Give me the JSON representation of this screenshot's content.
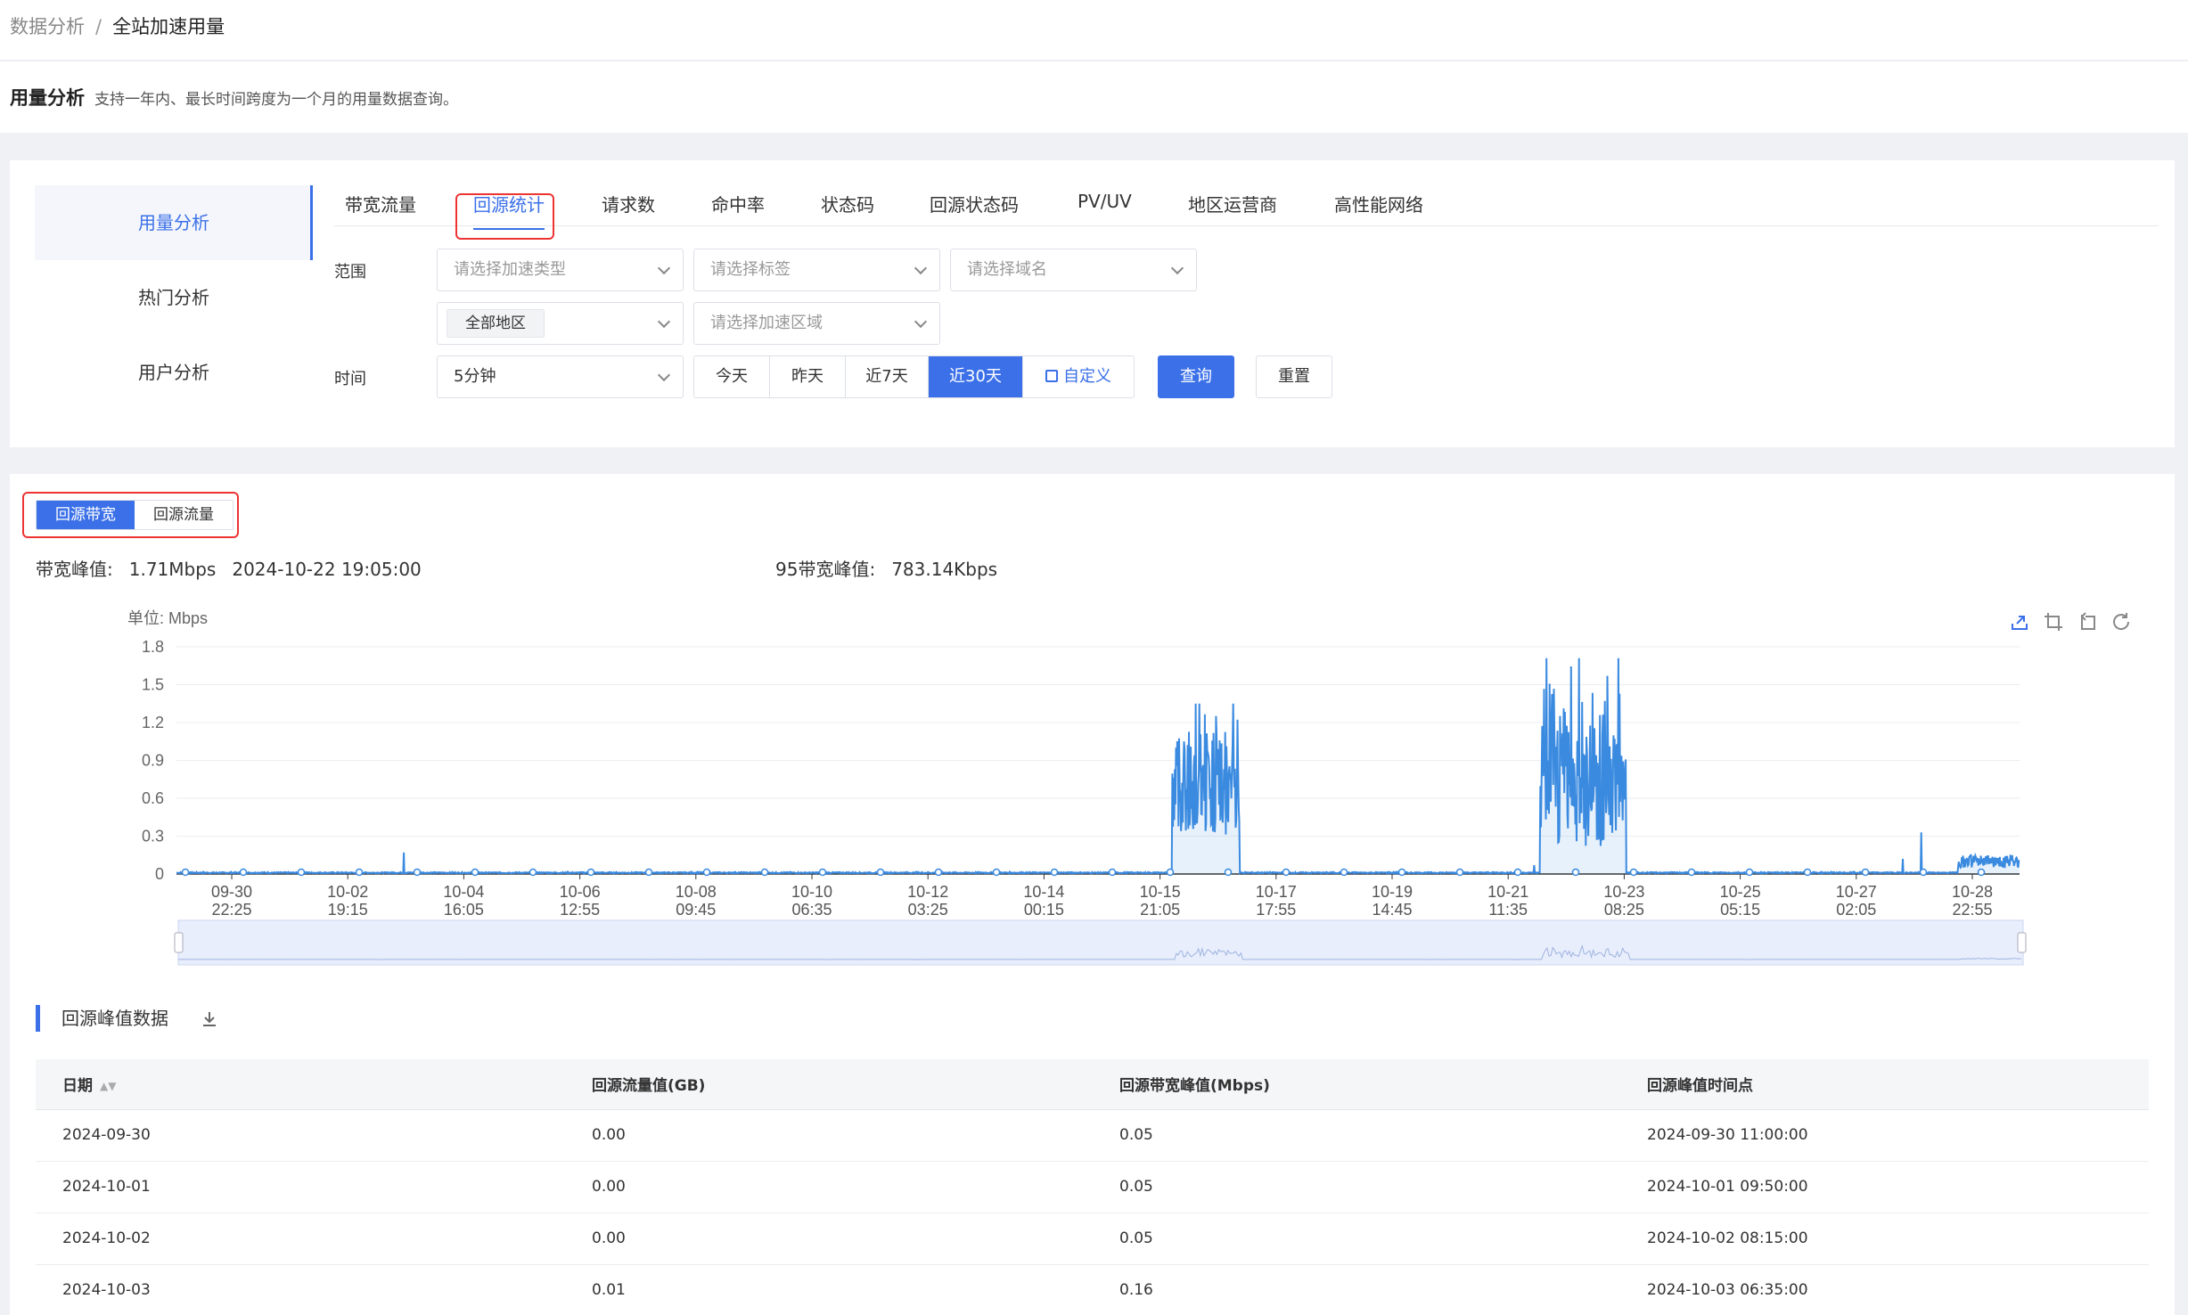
{
  "breadcrumb": {
    "parent": "数据分析",
    "separator": "/",
    "current": "全站加速用量"
  },
  "header": {
    "title": "用量分析",
    "description": "支持一年内、最长时间跨度为一个月的用量数据查询。"
  },
  "left_nav": {
    "items": [
      {
        "label": "用量分析",
        "active": true
      },
      {
        "label": "热门分析",
        "active": false
      },
      {
        "label": "用户分析",
        "active": false
      }
    ]
  },
  "tabs": [
    {
      "label": "带宽流量"
    },
    {
      "label": "回源统计",
      "active": true
    },
    {
      "label": "请求数"
    },
    {
      "label": "命中率"
    },
    {
      "label": "状态码"
    },
    {
      "label": "回源状态码"
    },
    {
      "label": "PV/UV"
    },
    {
      "label": "地区运营商"
    },
    {
      "label": "高性能网络"
    }
  ],
  "filters": {
    "scope_label": "范围",
    "accel_type_placeholder": "请选择加速类型",
    "tag_placeholder": "请选择标签",
    "domain_placeholder": "请选择域名",
    "region_value": "全部地区",
    "accel_region_placeholder": "请选择加速区域",
    "time_label": "时间",
    "granularity_value": "5分钟",
    "quick_ranges": [
      {
        "label": "今天"
      },
      {
        "label": "昨天"
      },
      {
        "label": "近7天"
      },
      {
        "label": "近30天",
        "active": true
      }
    ],
    "custom_label": "自定义",
    "query_button": "查询",
    "reset_button": "重置"
  },
  "subtabs": [
    {
      "label": "回源带宽",
      "active": true
    },
    {
      "label": "回源流量"
    }
  ],
  "stats": {
    "peak_label": "带宽峰值:",
    "peak_value": "1.71Mbps",
    "peak_time": "2024-10-22 19:05:00",
    "p95_label": "95带宽峰值:",
    "p95_value": "783.14Kbps"
  },
  "chart_data": {
    "type": "line",
    "unit_label": "单位: Mbps",
    "ylim": [
      0,
      1.8
    ],
    "yticks": [
      0,
      0.3,
      0.6,
      0.9,
      1.2,
      1.5,
      1.8
    ],
    "xticks": [
      [
        "09-30",
        "22:25"
      ],
      [
        "10-02",
        "19:15"
      ],
      [
        "10-04",
        "16:05"
      ],
      [
        "10-06",
        "12:55"
      ],
      [
        "10-08",
        "09:45"
      ],
      [
        "10-10",
        "06:35"
      ],
      [
        "10-12",
        "03:25"
      ],
      [
        "10-14",
        "00:15"
      ],
      [
        "10-15",
        "21:05"
      ],
      [
        "10-17",
        "17:55"
      ],
      [
        "10-19",
        "14:45"
      ],
      [
        "10-21",
        "11:35"
      ],
      [
        "10-23",
        "08:25"
      ],
      [
        "10-25",
        "05:15"
      ],
      [
        "10-27",
        "02:05"
      ],
      [
        "10-28",
        "22:55"
      ]
    ],
    "xrange_days": [
      0,
      30
    ],
    "series": [
      {
        "color": "#3a8ae0"
      }
    ],
    "bursts": [
      {
        "start_day": 16.2,
        "end_day": 17.3,
        "low": 0.3,
        "high": 1.35
      },
      {
        "start_day": 22.2,
        "end_day": 23.6,
        "low": 0.2,
        "high": 1.71
      }
    ],
    "spikes": [
      {
        "day": 3.7,
        "value": 0.17
      },
      {
        "day": 22.1,
        "value": 0.07
      },
      {
        "day": 28.4,
        "value": 0.33
      },
      {
        "day": 28.1,
        "value": 0.12
      }
    ],
    "tail": {
      "start_day": 29.0,
      "end_day": 30.0,
      "low": 0.05,
      "high": 0.15
    }
  },
  "table": {
    "title": "回源峰值数据",
    "columns": [
      "日期",
      "回源流量值(GB)",
      "回源带宽峰值(Mbps)",
      "回源峰值时间点"
    ],
    "rows": [
      [
        "2024-09-30",
        "0.00",
        "0.05",
        "2024-09-30 11:00:00"
      ],
      [
        "2024-10-01",
        "0.00",
        "0.05",
        "2024-10-01 09:50:00"
      ],
      [
        "2024-10-02",
        "0.00",
        "0.05",
        "2024-10-02 08:15:00"
      ],
      [
        "2024-10-03",
        "0.01",
        "0.16",
        "2024-10-03 06:35:00"
      ]
    ]
  }
}
